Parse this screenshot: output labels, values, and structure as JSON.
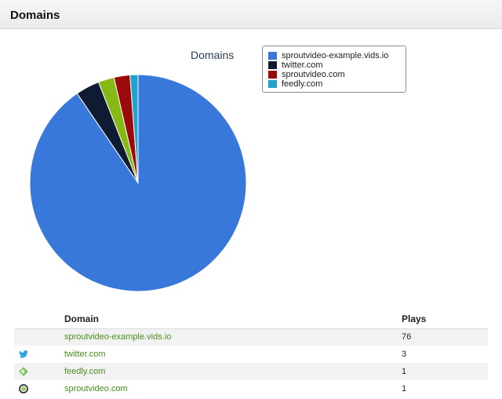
{
  "header": {
    "title": "Domains"
  },
  "chart_data": {
    "type": "pie",
    "title": "Domains",
    "legend_position": "top-right",
    "categories": [
      "sproutvideo-example.vids.io",
      "twitter.com",
      "sproutvideo.com",
      "feedly.com"
    ],
    "values": [
      76,
      3,
      2,
      1
    ],
    "colors": [
      "#3878db",
      "#0f1b32",
      "#9a0a0a",
      "#1fa3cc"
    ],
    "extra_slices": [
      {
        "value": 2,
        "color": "#86b916"
      }
    ]
  },
  "table": {
    "headers": {
      "domain": "Domain",
      "plays": "Plays"
    },
    "rows": [
      {
        "icon": "",
        "domain": "sproutvideo-example.vids.io",
        "plays": "76"
      },
      {
        "icon": "twitter-icon",
        "domain": "twitter.com",
        "plays": "3"
      },
      {
        "icon": "feedly-icon",
        "domain": "feedly.com",
        "plays": "1"
      },
      {
        "icon": "sproutvideo-icon",
        "domain": "sproutvideo.com",
        "plays": "1"
      }
    ]
  }
}
